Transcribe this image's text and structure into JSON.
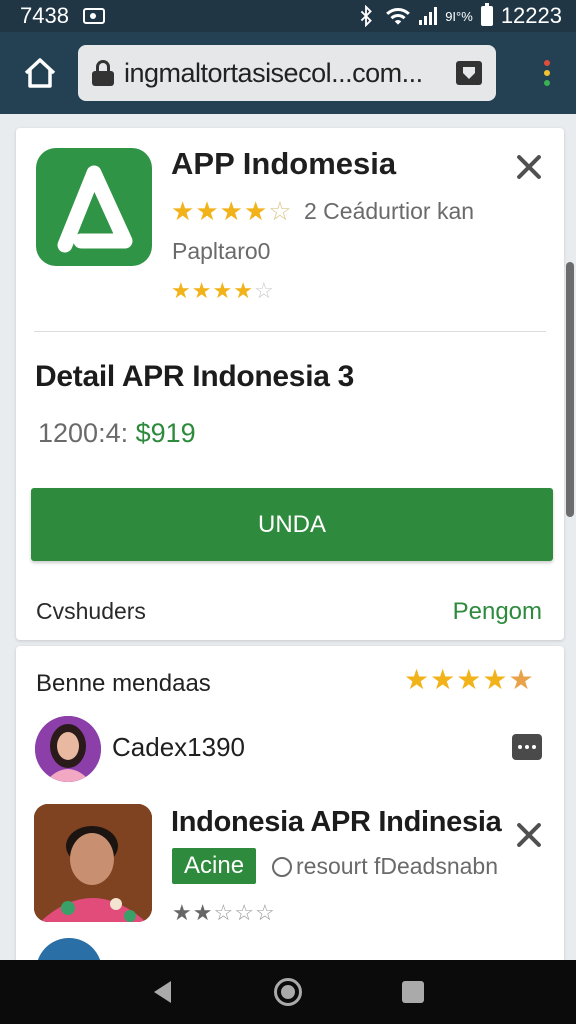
{
  "status_bar": {
    "time": "7438",
    "carrier_small": "9I°%",
    "right_time": "12223"
  },
  "browser": {
    "url": "ingmaltortasisecol...com..."
  },
  "app_card": {
    "title": "APP Indomesia",
    "rating_text": "2 Ceádurtior kan",
    "publisher": "Papltaro0",
    "rating_stars": 4,
    "rating_stars_secondary": 4,
    "detail_title": "Detail APR Indonesia 3",
    "price_label": "1200:4:",
    "price_value": "$919",
    "cta_label": "UNDA",
    "footer_left": "Cvshuders",
    "footer_link": "Pengom",
    "accent_color": "#2e8a3c",
    "star_color": "#f1b21a"
  },
  "review_card": {
    "section_title": "Benne mendaas",
    "section_stars": 4.5,
    "user_name": "Cadex1390",
    "item_title": "Indonesia APR Indinesia",
    "badge_label": "Acine",
    "resource_text": "resourt fDeadsnabn",
    "item_stars": 2,
    "partial_row_text": "..."
  }
}
